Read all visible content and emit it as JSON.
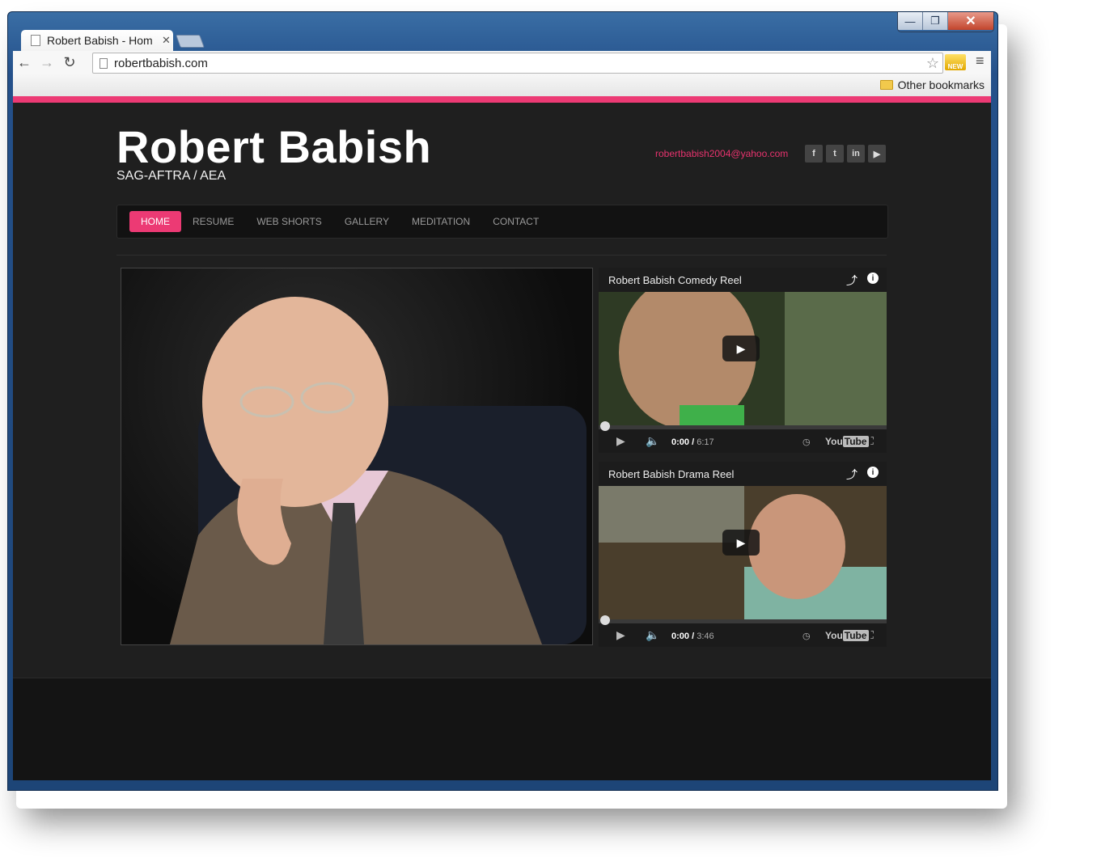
{
  "browser": {
    "tab_title": "Robert Babish - Hom",
    "url": "robertbabish.com",
    "bookmark_other": "Other bookmarks",
    "ext_badge": "NEW"
  },
  "site": {
    "title": "Robert Babish",
    "subtitle": "SAG-AFTRA / AEA",
    "email": "robertbabish2004@yahoo.com",
    "social": [
      {
        "icon": "facebook-icon",
        "glyph": "f"
      },
      {
        "icon": "twitter-icon",
        "glyph": "t"
      },
      {
        "icon": "linkedin-icon",
        "glyph": "in"
      },
      {
        "icon": "youtube-icon",
        "glyph": "▶"
      }
    ],
    "nav": [
      "HOME",
      "RESUME",
      "WEB SHORTS",
      "GALLERY",
      "MEDITATION",
      "CONTACT"
    ]
  },
  "videos": [
    {
      "title": "Robert Babish Comedy Reel",
      "current": "0:00",
      "duration": "6:17"
    },
    {
      "title": "Robert Babish Drama Reel",
      "current": "0:00",
      "duration": "3:46"
    }
  ],
  "colors": {
    "accent": "#ec3a74",
    "background": "#1f1f1f"
  }
}
